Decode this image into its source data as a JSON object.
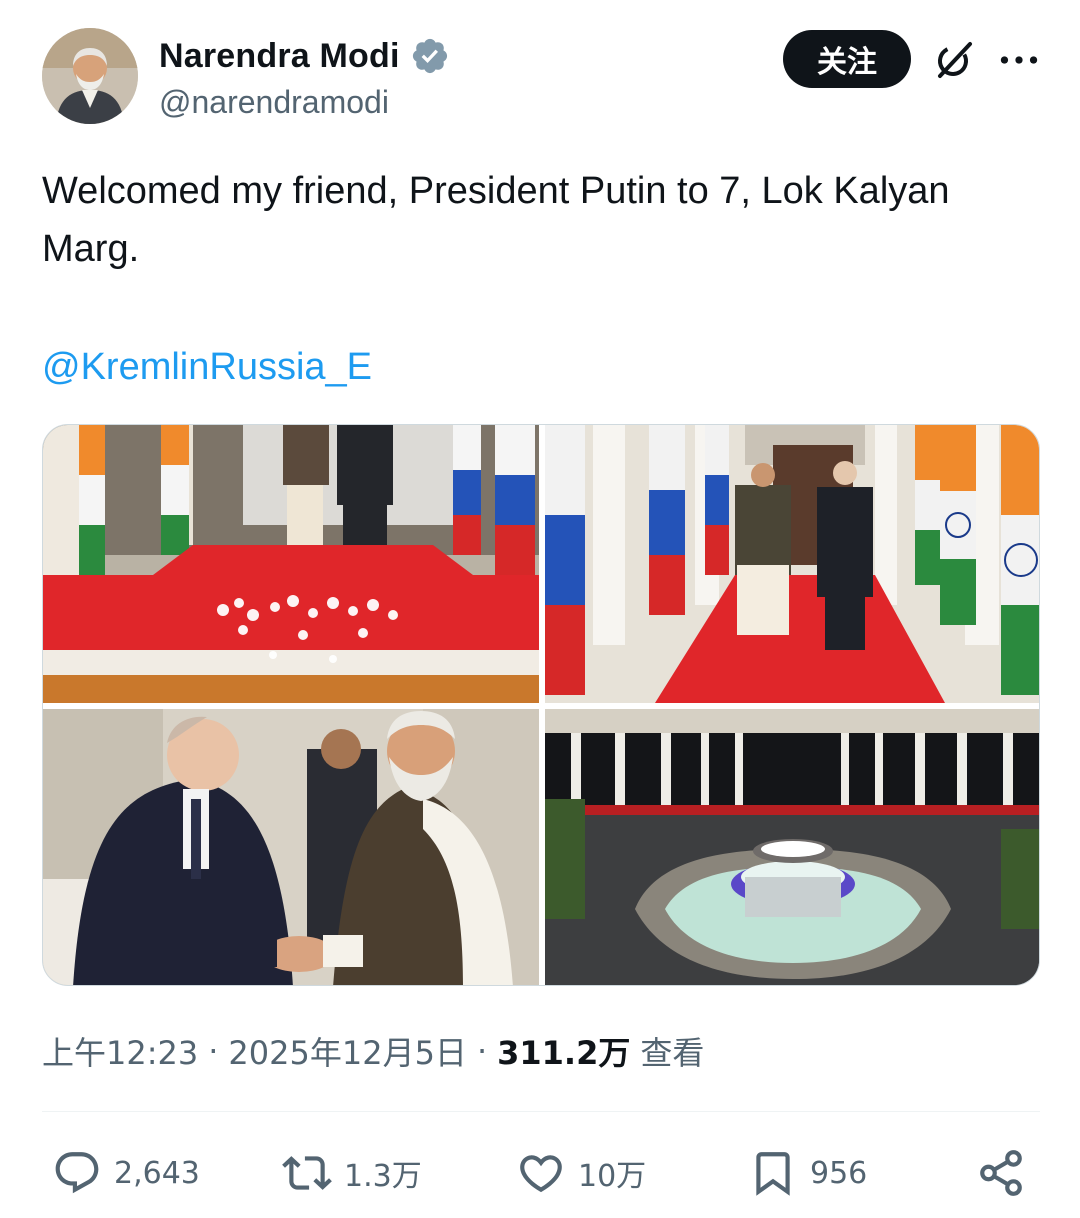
{
  "author": {
    "display_name": "Narendra Modi",
    "handle": "@narendramodi",
    "verified_icon": "verified-badge-icon"
  },
  "follow_button": "关注",
  "icons": {
    "grok": "grok-icon",
    "more": "more-icon",
    "reply": "reply-icon",
    "retweet": "retweet-icon",
    "like": "heart-icon",
    "bookmark": "bookmark-icon",
    "share": "share-icon"
  },
  "tweet": {
    "text": "Welcomed my friend, President Putin to 7, Lok Kalyan Marg.",
    "mention": "@KremlinRussia_E"
  },
  "meta": {
    "time": "上午12:23",
    "date": "2025年12月5日",
    "views": "311.2万",
    "views_label": "查看",
    "separator": "·"
  },
  "stats": {
    "replies": "2,643",
    "retweets": "1.3万",
    "likes": "10万",
    "bookmarks": "956"
  },
  "colors": {
    "accent": "#1d9bf0",
    "text": "#0f1419",
    "muted": "#536471",
    "red_carpet": "#e0262a"
  }
}
